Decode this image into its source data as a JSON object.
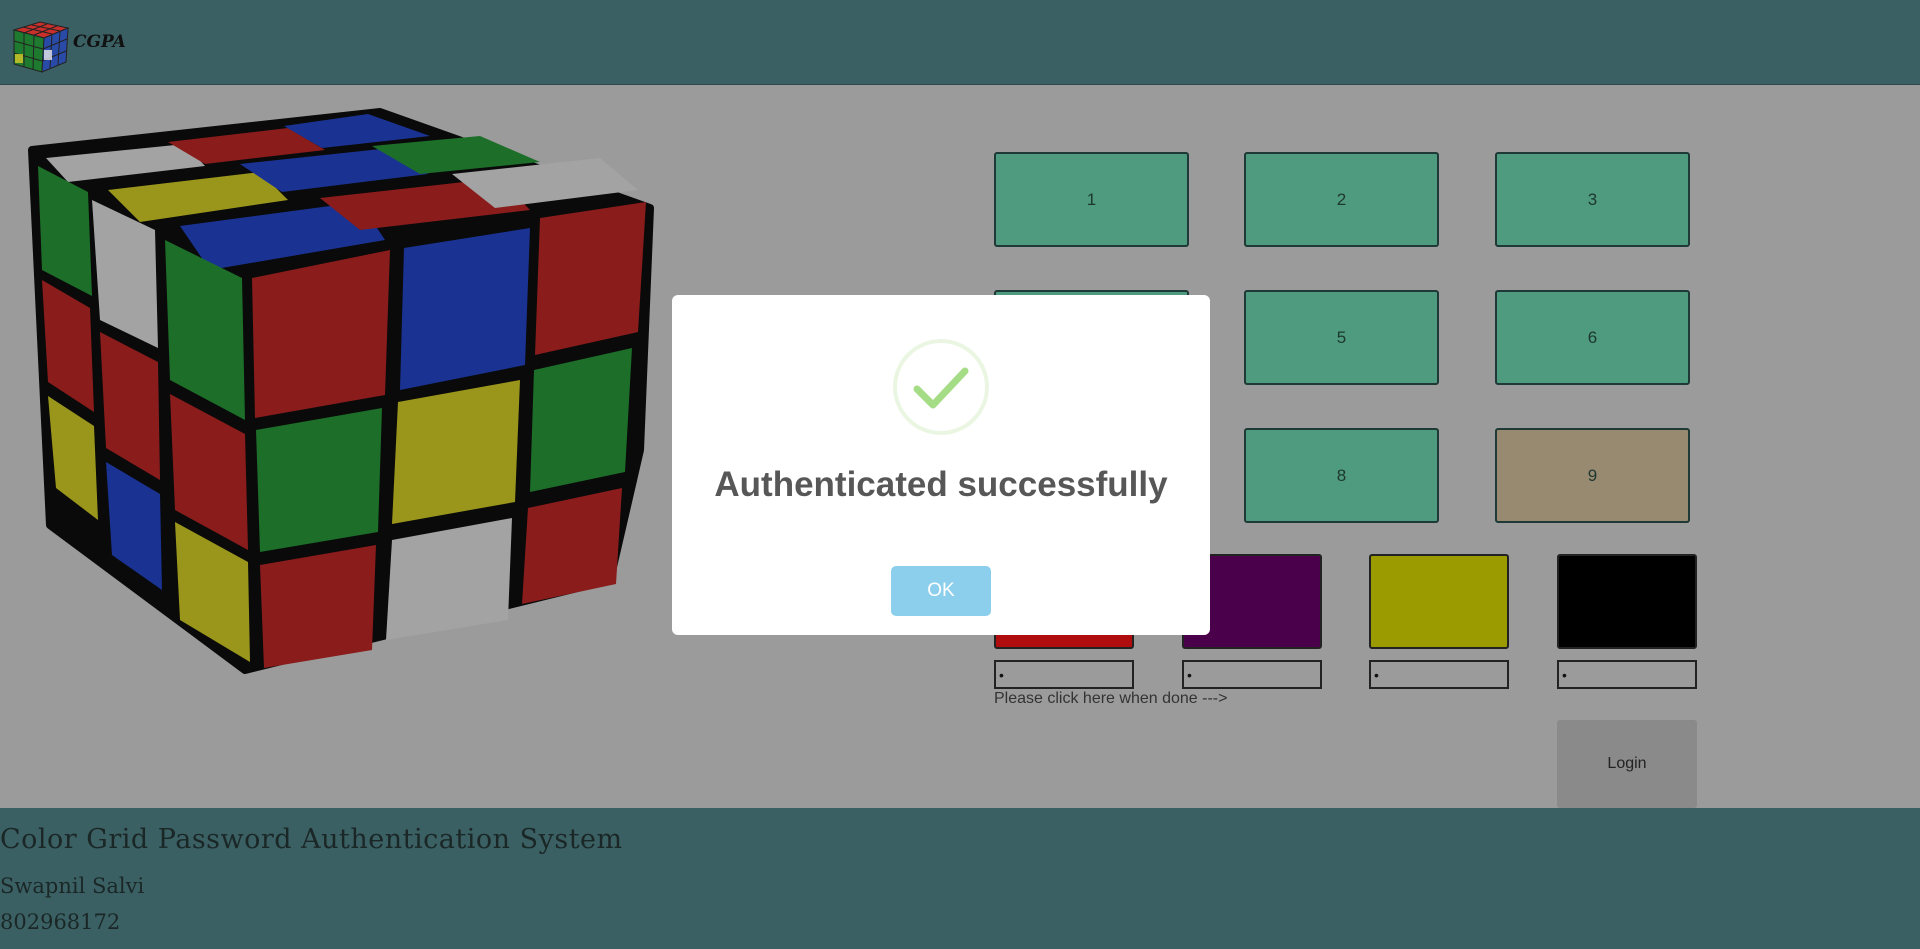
{
  "header": {
    "logo_text": "CGPA"
  },
  "grid": {
    "buttons": [
      {
        "label": "1",
        "selected": false
      },
      {
        "label": "2",
        "selected": false
      },
      {
        "label": "3",
        "selected": false
      },
      {
        "label": "",
        "selected": false
      },
      {
        "label": "5",
        "selected": false
      },
      {
        "label": "6",
        "selected": false
      },
      {
        "label": "",
        "selected": false
      },
      {
        "label": "8",
        "selected": false
      },
      {
        "label": "9",
        "selected": true
      }
    ]
  },
  "swatches": [
    {
      "color": "#b00e0e",
      "input_value": "•"
    },
    {
      "color": "#4a004a",
      "input_value": "•"
    },
    {
      "color": "#9b9b00",
      "input_value": "•"
    },
    {
      "color": "#000000",
      "input_value": "•"
    }
  ],
  "hint_text": "Please click here when done --->",
  "login_label": "Login",
  "footer": {
    "title": "Color Grid Password Authentication System",
    "name": "Swapnil Salvi",
    "id": "802968172"
  },
  "modal": {
    "title": "Authenticated successfully",
    "ok_label": "OK",
    "icon": "success-check-icon"
  },
  "colors": {
    "header_bg": "#3a6063",
    "grid_button": "#4e9b7f",
    "grid_button_selected": "#978a71",
    "ok_button": "#8ccfed",
    "check": "#a5dc86"
  }
}
